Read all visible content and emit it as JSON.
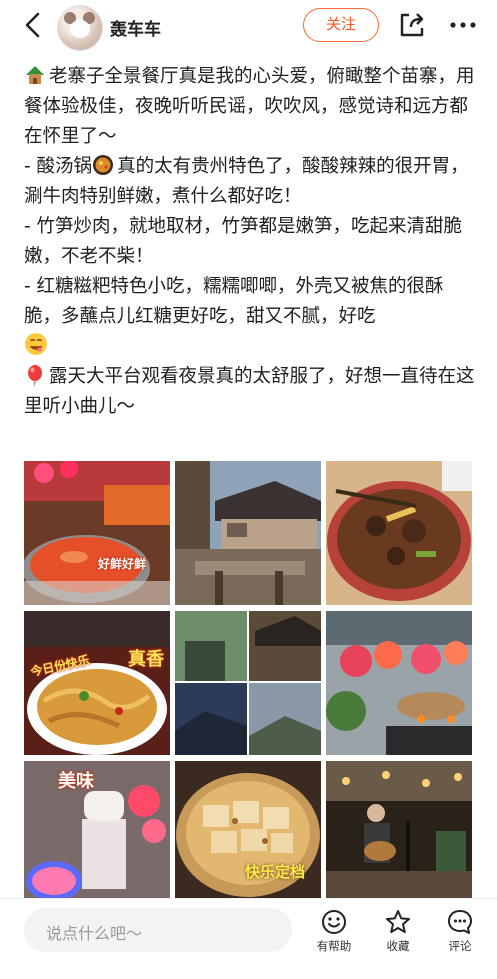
{
  "header": {
    "username": "轰车车",
    "follow_label": "关注"
  },
  "post": {
    "lines": [
      "老寨子全景餐厅真是我的心头爱，俯瞰整个苗寨，用餐体验极佳，夜晚听听民谣，吹吹风，感觉诗和远方都在怀里了～",
      "- 酸汤锅",
      "真的太有贵州特色了，酸酸辣辣的很开胃，涮牛肉特别鲜嫩，煮什么都好吃！",
      "- 竹笋炒肉，就地取材，竹笋都是嫩笋，吃起来清甜脆嫩，不老不柴！",
      "- 红糖糍粑特色小吃，糯糯唧唧，外壳又被焦的很酥脆，多蘸点儿红糖更好吃，甜又不腻，好吃",
      "露天大平台观看夜景真的太舒服了，好想一直待在这里听小曲儿～"
    ]
  },
  "photos": {
    "tags": {
      "p1": "好鲜好鲜",
      "p4a": "今日份快乐",
      "p4b": "真香",
      "p7": "美味",
      "p8": "快乐定档"
    }
  },
  "bottom": {
    "comment_placeholder": "说点什么吧～",
    "helpful_label": "有帮助",
    "favorite_label": "收藏",
    "comment_label": "评论"
  },
  "colors": {
    "accent": "#ff5a26",
    "text": "#1f1f1f",
    "muted": "#999999"
  }
}
